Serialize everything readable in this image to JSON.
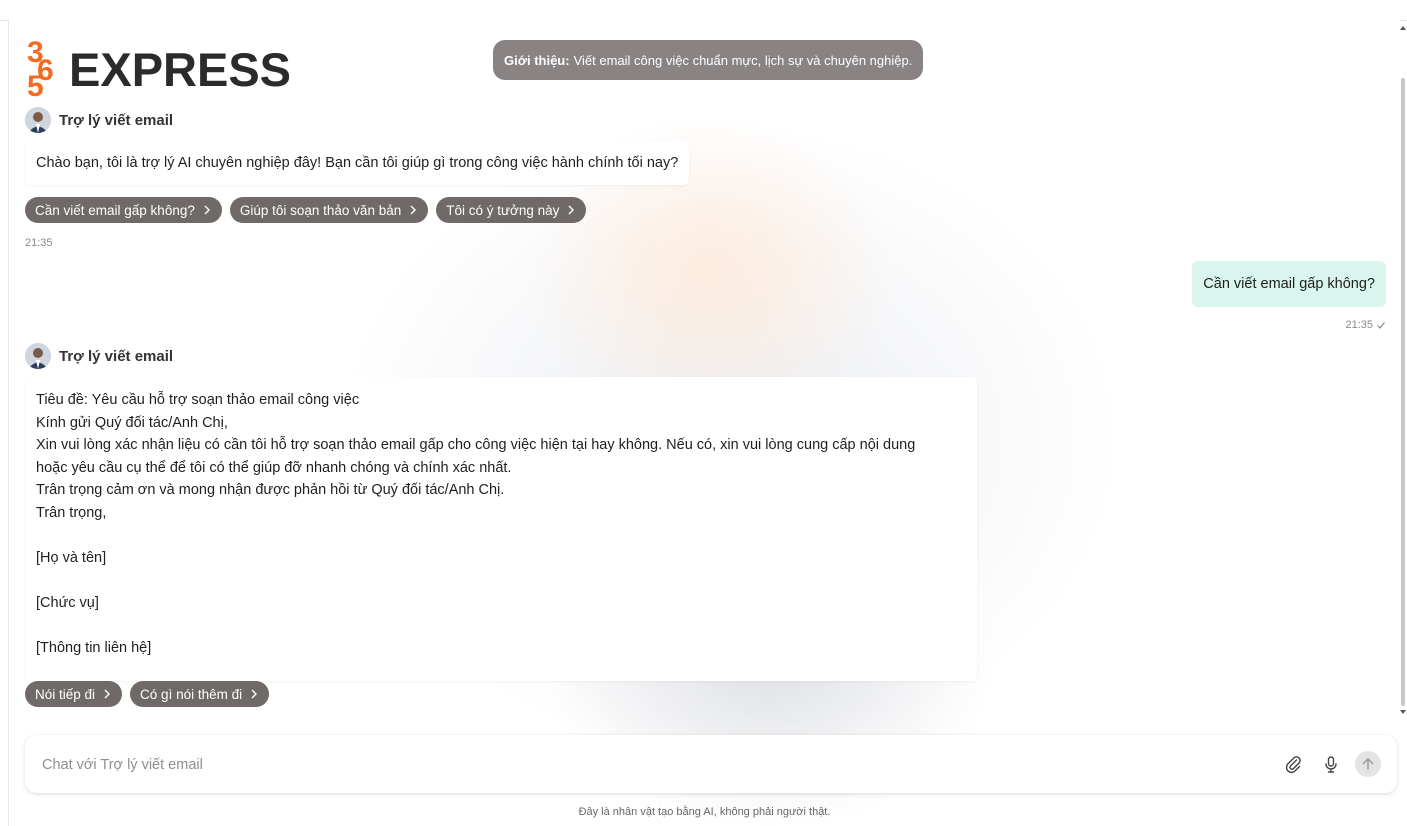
{
  "brand": {
    "logo_text": "EXPRESS",
    "logo_digits": "365",
    "accent_color": "#f26b21"
  },
  "intro": {
    "label": "Giới thiệu:",
    "text": "Viết email công việc chuẩn mực, lịch sự và chuyên nghiệp."
  },
  "assistant": {
    "name": "Trợ lý viết email"
  },
  "messages": {
    "greeting": {
      "text": "Chào bạn, tôi là trợ lý AI chuyên nghiệp đây! Bạn cần tôi giúp gì trong công việc hành chính tối nay?",
      "time": "21:35",
      "suggestions": [
        "Cần viết email gấp không?",
        "Giúp tôi soạn thảo văn bản",
        "Tôi có ý tưởng này"
      ]
    },
    "user": {
      "text": "Cần viết email gấp không?",
      "time": "21:35",
      "status_icon": "check-icon"
    },
    "reply": {
      "lines": [
        "Tiêu đề: Yêu cầu hỗ trợ soạn thảo email công việc",
        "Kính gửi Quý đối tác/Anh Chị,",
        "Xin vui lòng xác nhận liệu có cần tôi hỗ trợ soạn thảo email gấp cho công việc hiện tại hay không. Nếu có, xin vui lòng cung cấp nội dung",
        "hoặc yêu cầu cụ thể để tôi có thể giúp đỡ nhanh chóng và chính xác nhất.",
        "Trân trọng cảm ơn và mong nhận được phản hồi từ Quý đối tác/Anh Chị.",
        "Trân trọng,",
        "[Họ và tên]",
        "[Chức vụ]",
        "[Thông tin liên hệ]"
      ],
      "suggestions": [
        "Nói tiếp đi",
        "Có gì nói thêm đi"
      ]
    }
  },
  "composer": {
    "placeholder": "Chat với Trợ lý viết email",
    "icons": [
      "paperclip-icon",
      "microphone-icon",
      "send-arrow-icon"
    ]
  },
  "footer": {
    "disclaimer": "Đây là nhân vật tạo bằng AI, không phải người thật."
  }
}
